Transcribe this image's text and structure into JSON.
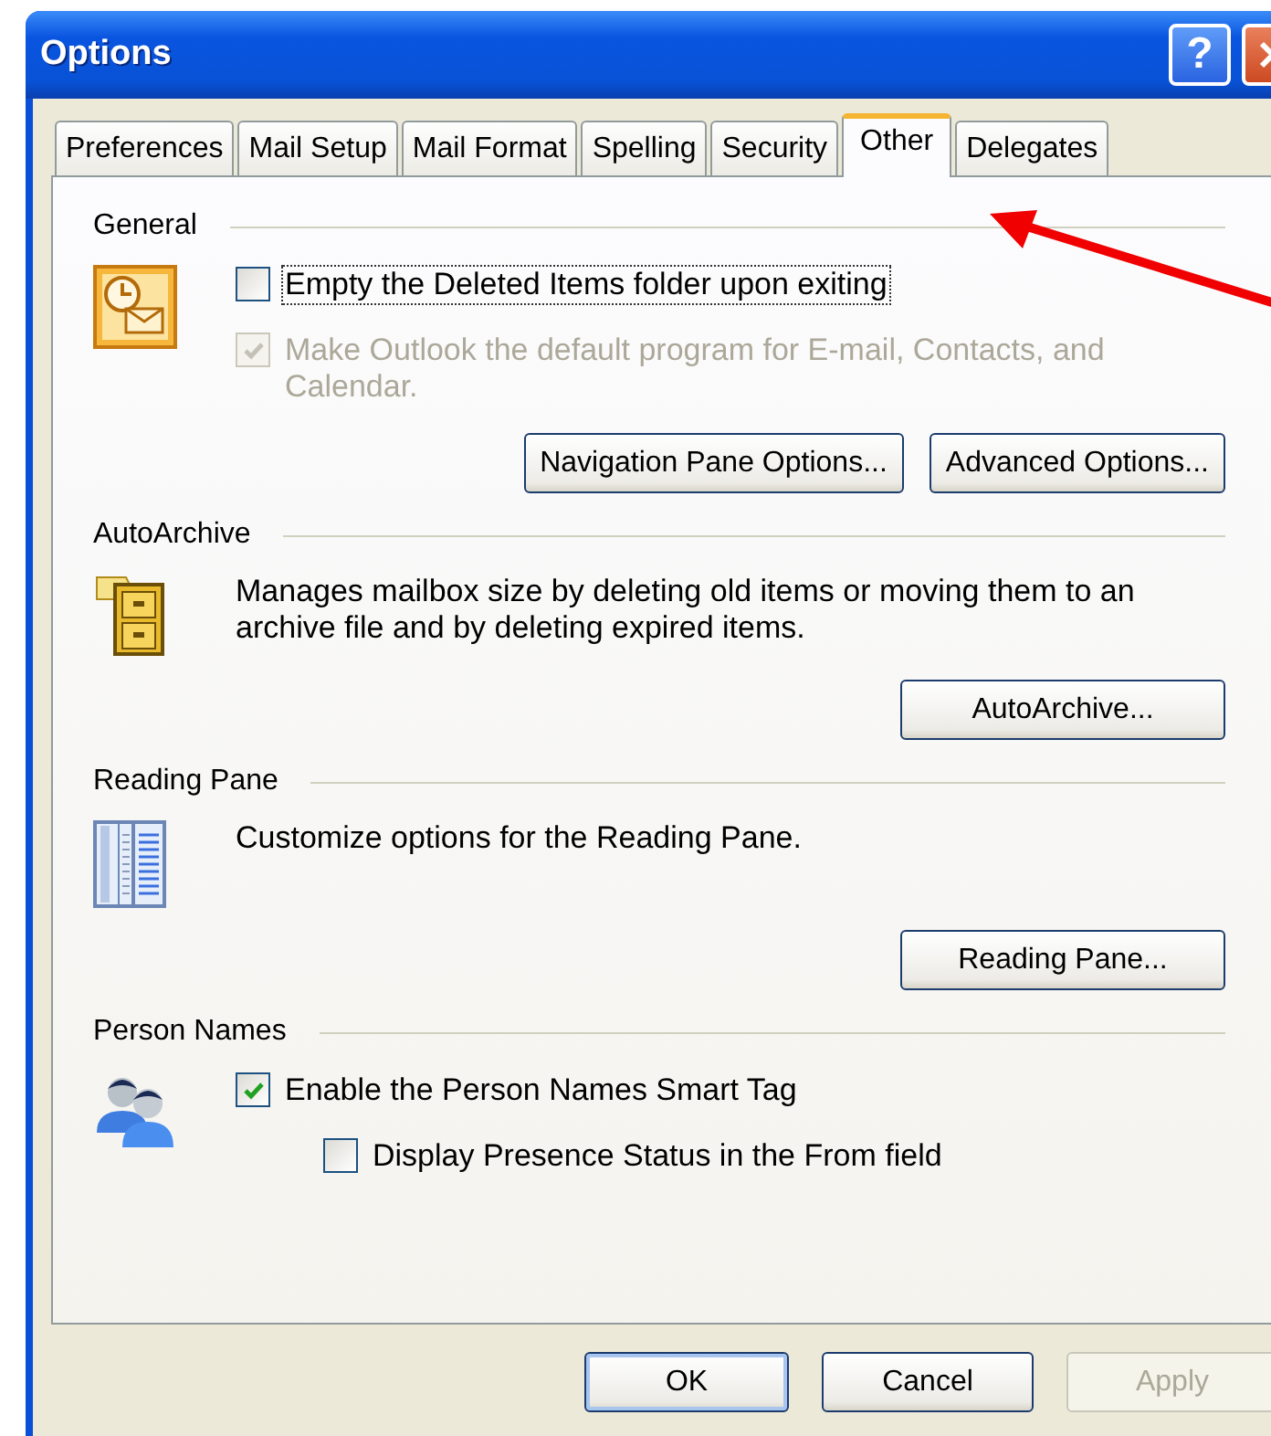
{
  "window": {
    "title": "Options",
    "help_button": "?"
  },
  "tabs": [
    {
      "label": "Preferences",
      "selected": false
    },
    {
      "label": "Mail Setup",
      "selected": false
    },
    {
      "label": "Mail Format",
      "selected": false
    },
    {
      "label": "Spelling",
      "selected": false
    },
    {
      "label": "Security",
      "selected": false
    },
    {
      "label": "Other",
      "selected": true
    },
    {
      "label": "Delegates",
      "selected": false
    }
  ],
  "sections": [
    {
      "heading": "General",
      "items": [
        {
          "kind": "checkbox",
          "label": "Empty the Deleted Items folder upon exiting",
          "checked": false,
          "disabled": false,
          "focused": true
        },
        {
          "kind": "checkbox",
          "label": "Make Outlook the default program for E-mail, Contacts, and Calendar.",
          "checked": true,
          "disabled": true,
          "focused": false
        }
      ],
      "buttons": [
        {
          "label": "Navigation Pane Options...",
          "disabled": false
        },
        {
          "label": "Advanced Options...",
          "disabled": false
        }
      ]
    },
    {
      "heading": "AutoArchive",
      "items": [
        {
          "kind": "text",
          "text": "Manages mailbox size by deleting old items or moving them to an archive file and by deleting expired items."
        }
      ],
      "buttons": [
        {
          "label": "AutoArchive...",
          "disabled": false
        }
      ]
    },
    {
      "heading": "Reading Pane",
      "items": [
        {
          "kind": "text",
          "text": "Customize options for the Reading Pane."
        }
      ],
      "buttons": [
        {
          "label": "Reading Pane...",
          "disabled": false
        }
      ]
    },
    {
      "heading": "Person Names",
      "items": [
        {
          "kind": "checkbox",
          "label": "Enable the Person Names Smart Tag",
          "checked": true,
          "disabled": false,
          "focused": false,
          "children": [
            {
              "kind": "checkbox",
              "label": "Display Presence Status in the From field",
              "checked": false,
              "disabled": false,
              "focused": false
            }
          ]
        }
      ]
    }
  ],
  "footer_buttons": [
    {
      "label": "OK",
      "disabled": false,
      "default": true
    },
    {
      "label": "Cancel",
      "disabled": false,
      "default": false
    },
    {
      "label": "Apply",
      "disabled": true,
      "default": false
    }
  ]
}
